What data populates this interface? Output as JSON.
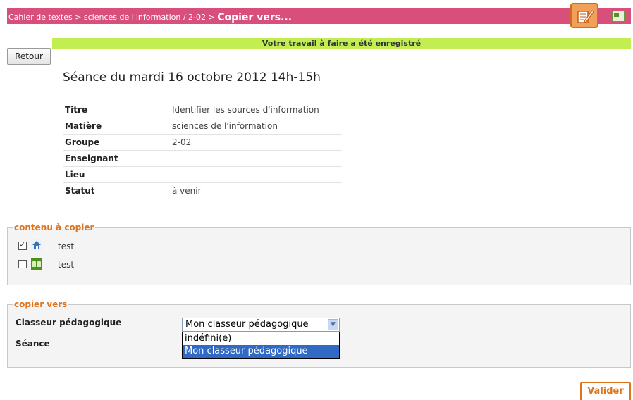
{
  "header": {
    "breadcrumb": "Cahier de textes > sciences de l'information / 2-02 >",
    "current": "Copier vers..."
  },
  "message": "Votre travail à faire a été enregistré",
  "back_label": "Retour",
  "session_title": "Séance du mardi 16 octobre 2012 14h-15h",
  "info": [
    {
      "label": "Titre",
      "value": "Identifier les sources d'information"
    },
    {
      "label": "Matière",
      "value": "sciences de l'information"
    },
    {
      "label": "Groupe",
      "value": "2-02"
    },
    {
      "label": "Enseignant",
      "value": ""
    },
    {
      "label": "Lieu",
      "value": "-"
    },
    {
      "label": "Statut",
      "value": "à venir"
    }
  ],
  "content_section": {
    "legend": "contenu à copier",
    "items": [
      {
        "label": "test",
        "checked": true,
        "icon": "home-icon"
      },
      {
        "label": "test",
        "checked": false,
        "icon": "group-icon"
      }
    ]
  },
  "copy_section": {
    "legend": "copier vers",
    "binder_label": "Classeur pédagogique",
    "session_label": "Séance",
    "selected": "Mon classeur pédagogique",
    "options": [
      "indéfini(e)",
      "Mon classeur pédagogique"
    ]
  },
  "submit_label": "Valider",
  "colors": {
    "header": "#d94f7b",
    "message_bar": "#c3ee52",
    "accent": "#e0741d",
    "selection": "#316ac5"
  }
}
